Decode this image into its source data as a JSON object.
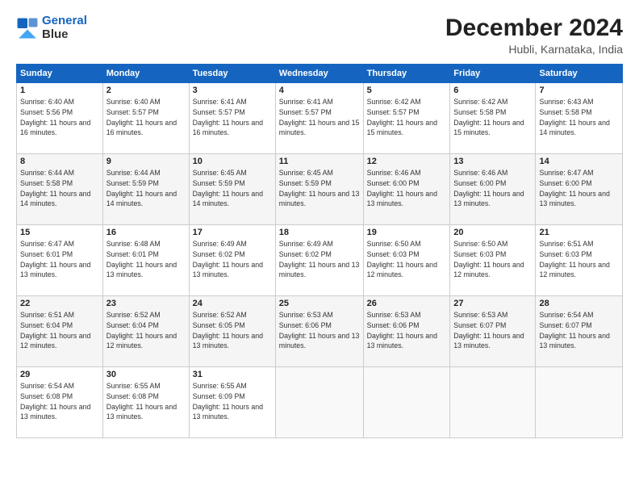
{
  "logo": {
    "line1": "General",
    "line2": "Blue"
  },
  "header": {
    "month": "December 2024",
    "location": "Hubli, Karnataka, India"
  },
  "weekdays": [
    "Sunday",
    "Monday",
    "Tuesday",
    "Wednesday",
    "Thursday",
    "Friday",
    "Saturday"
  ],
  "weeks": [
    [
      {
        "day": 1,
        "sunrise": "6:40 AM",
        "sunset": "5:56 PM",
        "daylight": "11 hours and 16 minutes."
      },
      {
        "day": 2,
        "sunrise": "6:40 AM",
        "sunset": "5:57 PM",
        "daylight": "11 hours and 16 minutes."
      },
      {
        "day": 3,
        "sunrise": "6:41 AM",
        "sunset": "5:57 PM",
        "daylight": "11 hours and 16 minutes."
      },
      {
        "day": 4,
        "sunrise": "6:41 AM",
        "sunset": "5:57 PM",
        "daylight": "11 hours and 15 minutes."
      },
      {
        "day": 5,
        "sunrise": "6:42 AM",
        "sunset": "5:57 PM",
        "daylight": "11 hours and 15 minutes."
      },
      {
        "day": 6,
        "sunrise": "6:42 AM",
        "sunset": "5:58 PM",
        "daylight": "11 hours and 15 minutes."
      },
      {
        "day": 7,
        "sunrise": "6:43 AM",
        "sunset": "5:58 PM",
        "daylight": "11 hours and 14 minutes."
      }
    ],
    [
      {
        "day": 8,
        "sunrise": "6:44 AM",
        "sunset": "5:58 PM",
        "daylight": "11 hours and 14 minutes."
      },
      {
        "day": 9,
        "sunrise": "6:44 AM",
        "sunset": "5:59 PM",
        "daylight": "11 hours and 14 minutes."
      },
      {
        "day": 10,
        "sunrise": "6:45 AM",
        "sunset": "5:59 PM",
        "daylight": "11 hours and 14 minutes."
      },
      {
        "day": 11,
        "sunrise": "6:45 AM",
        "sunset": "5:59 PM",
        "daylight": "11 hours and 13 minutes."
      },
      {
        "day": 12,
        "sunrise": "6:46 AM",
        "sunset": "6:00 PM",
        "daylight": "11 hours and 13 minutes."
      },
      {
        "day": 13,
        "sunrise": "6:46 AM",
        "sunset": "6:00 PM",
        "daylight": "11 hours and 13 minutes."
      },
      {
        "day": 14,
        "sunrise": "6:47 AM",
        "sunset": "6:00 PM",
        "daylight": "11 hours and 13 minutes."
      }
    ],
    [
      {
        "day": 15,
        "sunrise": "6:47 AM",
        "sunset": "6:01 PM",
        "daylight": "11 hours and 13 minutes."
      },
      {
        "day": 16,
        "sunrise": "6:48 AM",
        "sunset": "6:01 PM",
        "daylight": "11 hours and 13 minutes."
      },
      {
        "day": 17,
        "sunrise": "6:49 AM",
        "sunset": "6:02 PM",
        "daylight": "11 hours and 13 minutes."
      },
      {
        "day": 18,
        "sunrise": "6:49 AM",
        "sunset": "6:02 PM",
        "daylight": "11 hours and 13 minutes."
      },
      {
        "day": 19,
        "sunrise": "6:50 AM",
        "sunset": "6:03 PM",
        "daylight": "11 hours and 12 minutes."
      },
      {
        "day": 20,
        "sunrise": "6:50 AM",
        "sunset": "6:03 PM",
        "daylight": "11 hours and 12 minutes."
      },
      {
        "day": 21,
        "sunrise": "6:51 AM",
        "sunset": "6:03 PM",
        "daylight": "11 hours and 12 minutes."
      }
    ],
    [
      {
        "day": 22,
        "sunrise": "6:51 AM",
        "sunset": "6:04 PM",
        "daylight": "11 hours and 12 minutes."
      },
      {
        "day": 23,
        "sunrise": "6:52 AM",
        "sunset": "6:04 PM",
        "daylight": "11 hours and 12 minutes."
      },
      {
        "day": 24,
        "sunrise": "6:52 AM",
        "sunset": "6:05 PM",
        "daylight": "11 hours and 13 minutes."
      },
      {
        "day": 25,
        "sunrise": "6:53 AM",
        "sunset": "6:06 PM",
        "daylight": "11 hours and 13 minutes."
      },
      {
        "day": 26,
        "sunrise": "6:53 AM",
        "sunset": "6:06 PM",
        "daylight": "11 hours and 13 minutes."
      },
      {
        "day": 27,
        "sunrise": "6:53 AM",
        "sunset": "6:07 PM",
        "daylight": "11 hours and 13 minutes."
      },
      {
        "day": 28,
        "sunrise": "6:54 AM",
        "sunset": "6:07 PM",
        "daylight": "11 hours and 13 minutes."
      }
    ],
    [
      {
        "day": 29,
        "sunrise": "6:54 AM",
        "sunset": "6:08 PM",
        "daylight": "11 hours and 13 minutes."
      },
      {
        "day": 30,
        "sunrise": "6:55 AM",
        "sunset": "6:08 PM",
        "daylight": "11 hours and 13 minutes."
      },
      {
        "day": 31,
        "sunrise": "6:55 AM",
        "sunset": "6:09 PM",
        "daylight": "11 hours and 13 minutes."
      },
      null,
      null,
      null,
      null
    ]
  ]
}
